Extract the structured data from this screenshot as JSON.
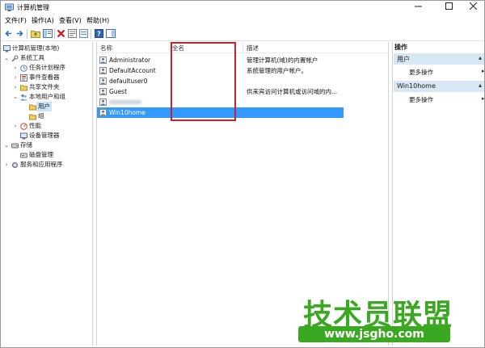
{
  "window": {
    "title": "计算机管理"
  },
  "menu": {
    "items": [
      "文件(F)",
      "操作(A)",
      "查看(V)",
      "帮助(H)"
    ]
  },
  "tree": {
    "items": [
      {
        "label": "计算机管理(本地)"
      },
      {
        "label": "系统工具"
      },
      {
        "label": "任务计划程序"
      },
      {
        "label": "事件查看器"
      },
      {
        "label": "共享文件夹"
      },
      {
        "label": "本地用户和组"
      },
      {
        "label": "用户"
      },
      {
        "label": "组"
      },
      {
        "label": "性能"
      },
      {
        "label": "设备管理器"
      },
      {
        "label": "存储"
      },
      {
        "label": "磁盘管理"
      },
      {
        "label": "服务和应用程序"
      }
    ]
  },
  "list": {
    "columns": [
      "名称",
      "全名",
      "描述"
    ],
    "rows": [
      {
        "name": "Administrator",
        "fullname": "",
        "description": "管理计算机(域)的内置帐户"
      },
      {
        "name": "DefaultAccount",
        "fullname": "",
        "description": "系统管理的用户帐户。"
      },
      {
        "name": "defaultuser0",
        "fullname": "",
        "description": ""
      },
      {
        "name": "Guest",
        "fullname": "",
        "description": "供来宾访问计算机或访问域的内..."
      },
      {
        "name": "",
        "fullname": "",
        "description": ""
      },
      {
        "name": "Win10home",
        "fullname": "",
        "description": ""
      }
    ]
  },
  "actions": {
    "title": "操作",
    "sections": [
      {
        "label": "用户",
        "item": "更多操作"
      },
      {
        "label": "Win10home",
        "item": "更多操作"
      }
    ]
  },
  "watermark": {
    "brand": "技术员联盟",
    "url": "www.jsgho.com"
  },
  "colors": {
    "selection": "#3399ff",
    "highlight_box": "#c0262b",
    "watermark": "#3aa821",
    "action_header": "#d7e7f3"
  }
}
